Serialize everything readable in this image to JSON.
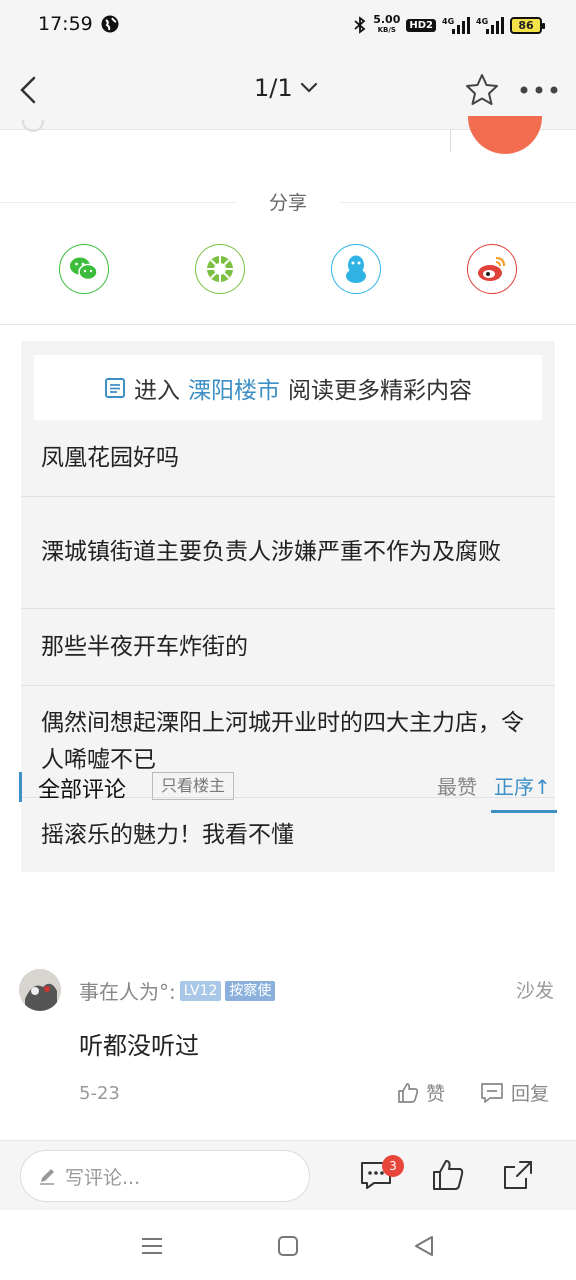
{
  "status_bar": {
    "time": "17:59",
    "speed_value": "5.00",
    "speed_unit": "KB/S",
    "hd_label": "HD2",
    "signal_1": "4G",
    "signal_2": "4G",
    "battery": "86"
  },
  "nav": {
    "page_indicator": "1/1"
  },
  "share": {
    "title": "分享",
    "items": [
      {
        "icon": "wechat-icon",
        "color": "#3bbd3b"
      },
      {
        "icon": "moments-icon",
        "color": "#7bc043"
      },
      {
        "icon": "qq-icon",
        "color": "#2fb3e5"
      },
      {
        "icon": "weibo-icon",
        "color": "#e0413a"
      }
    ]
  },
  "related": {
    "prefix": "进入",
    "forum_name": "溧阳楼市",
    "suffix": "阅读更多精彩内容",
    "items": [
      "凤凰花园好吗",
      "溧城镇街道主要负责人涉嫌严重不作为及腐败",
      "那些半夜开车炸街的",
      "偶然间想起溧阳上河城开业时的四大主力店，令人唏嘘不已",
      "摇滚乐的魅力！我看不懂"
    ]
  },
  "comments": {
    "title": "全部评论",
    "owner_only": "只看楼主",
    "sort_hot": "最赞",
    "sort_order": "正序↑",
    "list": [
      {
        "username": "事在人为°:",
        "level": "LV12",
        "role": "按察使",
        "floor": "沙发",
        "text": "听都没听过",
        "date": "5-23",
        "like_label": "赞",
        "reply_label": "回复"
      }
    ]
  },
  "bottom_bar": {
    "placeholder": "写评论...",
    "comment_count": "3"
  },
  "colors": {
    "accent": "#3d8fc6",
    "badge_red": "#e8463b"
  }
}
